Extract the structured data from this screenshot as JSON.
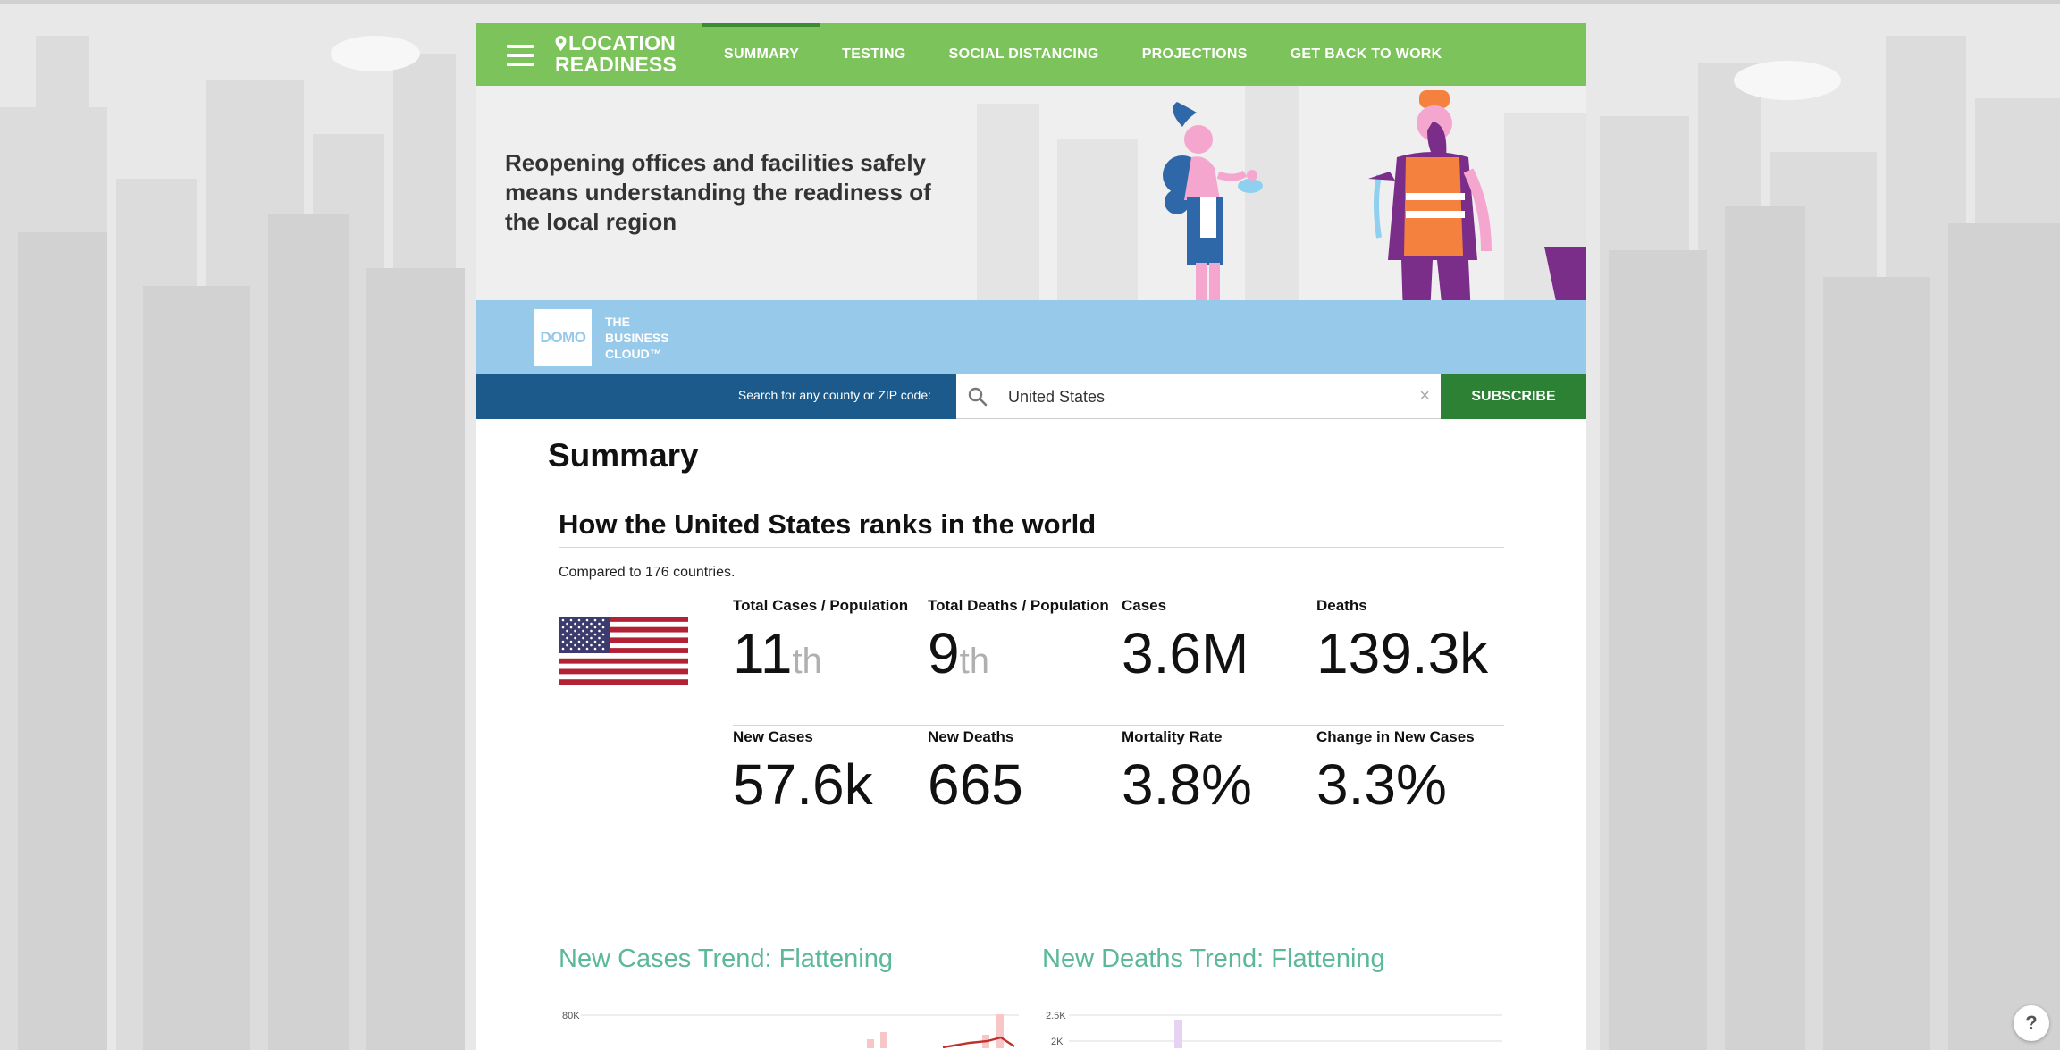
{
  "nav": {
    "brand_line1": "LOCATION",
    "brand_line2": "READINESS",
    "items": [
      {
        "label": "SUMMARY"
      },
      {
        "label": "TESTING"
      },
      {
        "label": "SOCIAL DISTANCING"
      },
      {
        "label": "PROJECTIONS"
      },
      {
        "label": "GET BACK TO WORK"
      }
    ],
    "active_item": "SUMMARY",
    "icons": [
      "menu-icon",
      "location-pin-icon"
    ]
  },
  "hero": {
    "headline": "Reopening offices and facilities safely means understanding the readiness of the local region"
  },
  "domo": {
    "logo_text": "DOMO",
    "tagline_line1": "THE",
    "tagline_line2": "BUSINESS",
    "tagline_line3": "CLOUD™"
  },
  "search": {
    "label": "Search for any county or ZIP code:",
    "value": "United States",
    "clear_glyph": "×",
    "subscribe_label": "SUBSCRIBE"
  },
  "summary": {
    "section_title": "Summary",
    "rank_title": "How the United States ranks in the world",
    "compared_text": "Compared to 176 countries.",
    "stats": [
      {
        "label": "Total Cases / Population",
        "value": "11",
        "suffix": "th"
      },
      {
        "label": "Total Deaths / Population",
        "value": "9",
        "suffix": "th"
      },
      {
        "label": "Cases",
        "value": "3.6M",
        "suffix": ""
      },
      {
        "label": "Deaths",
        "value": "139.3k",
        "suffix": ""
      },
      {
        "label": "New Cases",
        "value": "57.6k",
        "suffix": ""
      },
      {
        "label": "New Deaths",
        "value": "665",
        "suffix": ""
      },
      {
        "label": "Mortality Rate",
        "value": "3.8%",
        "suffix": ""
      },
      {
        "label": "Change in New Cases",
        "value": "3.3%",
        "suffix": ""
      }
    ]
  },
  "trends": {
    "cases_title": "New Cases Trend: Flattening",
    "deaths_title": "New Deaths Trend: Flattening",
    "cases_top_tick": "80K",
    "deaths_ticks": [
      "2.5K",
      "2K"
    ]
  },
  "help_glyph": "?",
  "colors": {
    "nav_green": "#7dc35b",
    "search_blue": "#1c5a8b",
    "subscribe_green": "#2c8135",
    "trend_teal": "#5cb89a",
    "band_blue": "#97c9ea"
  }
}
